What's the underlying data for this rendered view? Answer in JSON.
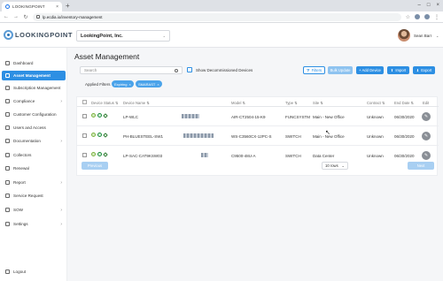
{
  "browser": {
    "tab_title": "LOOKINGPOINT",
    "tab_close": "×",
    "new_tab": "+",
    "window_controls": [
      "–",
      "□",
      "×"
    ],
    "nav": {
      "back": "←",
      "forward": "→",
      "reload": "↻"
    },
    "url": "lp.ecdia.io/inventory-management",
    "star": "☆",
    "kebab": "⋮"
  },
  "header": {
    "logo_text": "LOOKINGPOINT",
    "org_name": "LookingPoint, Inc.",
    "org_caret": "⌄",
    "user_name": "Sean Barr",
    "user_caret": "⌄"
  },
  "sidebar": {
    "items": [
      {
        "label": "Dashboard",
        "icon": "dashboard-icon",
        "arrow": ""
      },
      {
        "label": "Asset Management",
        "icon": "asset-icon",
        "arrow": ""
      },
      {
        "label": "Subscription Management",
        "icon": "subscription-icon",
        "arrow": ""
      },
      {
        "label": "Compliance",
        "icon": "compliance-icon",
        "arrow": "›"
      },
      {
        "label": "Customer Configuration",
        "icon": "customer-config-icon",
        "arrow": ""
      },
      {
        "label": "Users and Access",
        "icon": "users-icon",
        "arrow": ""
      },
      {
        "label": "Documentation",
        "icon": "documentation-icon",
        "arrow": "›"
      },
      {
        "label": "Collectors",
        "icon": "collectors-icon",
        "arrow": ""
      },
      {
        "label": "Renewal",
        "icon": "renewal-icon",
        "arrow": ""
      },
      {
        "label": "Report",
        "icon": "report-icon",
        "arrow": "›"
      },
      {
        "label": "Service Request",
        "icon": "service-request-icon",
        "arrow": ""
      },
      {
        "label": "SOW",
        "icon": "sow-icon",
        "arrow": "›"
      },
      {
        "label": "Settings",
        "icon": "settings-icon",
        "arrow": "›"
      },
      {
        "label": "Logout",
        "icon": "logout-icon",
        "arrow": ""
      }
    ],
    "active_index": 1
  },
  "main": {
    "title": "Asset Management",
    "search_placeholder": "Search",
    "decommissioned_label": "Show Decommissioned Devices",
    "buttons": {
      "filters": "Filters",
      "bulk_update": "Bulk Update",
      "add_device": "+ Add Device",
      "import": "Import",
      "export": "Export"
    },
    "applied_filters_label": "Applied Filters",
    "filter_chips": [
      "Expiring",
      "SMARAST"
    ],
    "chip_remove": "×",
    "columns": [
      "Device Status",
      "Device Name",
      "Model",
      "Type",
      "Site",
      "Contract",
      "End Date",
      "Edit"
    ],
    "sort_glyph": "⇅",
    "rows": [
      {
        "device_name": "LP-WLC",
        "model": "AIR-CT2504-15-K9",
        "type": "FUNCSYSTM",
        "site": "Main - New Office",
        "contract": "Unknown",
        "end_date": "06/30/2020"
      },
      {
        "device_name": "PH-BLUESTEEL-SW1",
        "model": "WS-C3560CX-12PC-S",
        "type": "SWITCH",
        "site": "Main - New Office",
        "contract": "Unknown",
        "end_date": "06/30/2020"
      },
      {
        "device_name": "LP-SAC-CAT9KSW03",
        "model": "C9500-48U-A",
        "type": "SWITCH",
        "site": "Data Center",
        "contract": "Unknown",
        "end_date": "06/30/2020"
      }
    ],
    "edit_glyph": "✎",
    "pager": {
      "previous": "Previous",
      "rows_per_page": "10 rows",
      "rows_caret": "⌄",
      "next": "Next"
    }
  },
  "colors": {
    "accent": "#2d8fe3",
    "sidebar_active": "#2d8fe3"
  }
}
